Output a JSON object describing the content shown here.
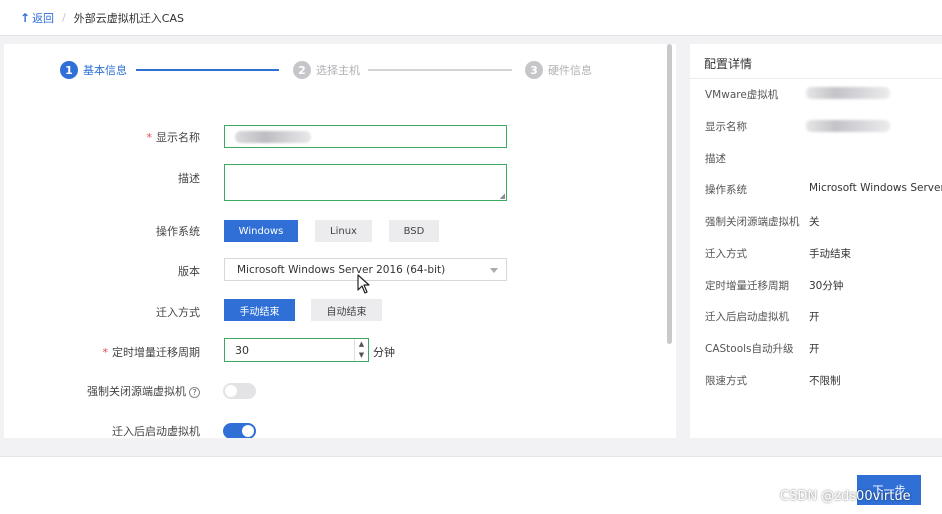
{
  "header": {
    "back_label": "返回",
    "title": "外部云虚拟机迁入CAS"
  },
  "steps": [
    {
      "num": "1",
      "label": "基本信息",
      "state": "active"
    },
    {
      "num": "2",
      "label": "选择主机",
      "state": "todo"
    },
    {
      "num": "3",
      "label": "硬件信息",
      "state": "todo"
    }
  ],
  "form": {
    "display_name_label": "显示名称",
    "description_label": "描述",
    "os_label": "操作系统",
    "os_options": [
      "Windows",
      "Linux",
      "BSD"
    ],
    "os_selected": "Windows",
    "version_label": "版本",
    "version_value": "Microsoft Windows Server 2016 (64-bit)",
    "migrate_mode_label": "迁入方式",
    "migrate_mode_options": [
      "手动结束",
      "自动结束"
    ],
    "migrate_mode_selected": "手动结束",
    "period_label": "定时增量迁移周期",
    "period_value": "30",
    "period_unit": "分钟",
    "force_shutdown_label": "强制关闭源端虚拟机",
    "force_shutdown_on": false,
    "start_after_label": "迁入后启动虚拟机",
    "start_after_on": true
  },
  "details": {
    "title": "配置详情",
    "rows": [
      {
        "key": "VMware虚拟机",
        "value": ""
      },
      {
        "key": "显示名称",
        "value": ""
      },
      {
        "key": "描述",
        "value": ""
      },
      {
        "key": "操作系统",
        "value": "Microsoft Windows Server"
      },
      {
        "key": "强制关闭源端虚拟机",
        "value": "关"
      },
      {
        "key": "迁入方式",
        "value": "手动结束"
      },
      {
        "key": "定时增量迁移周期",
        "value": "30分钟"
      },
      {
        "key": "迁入后启动虚拟机",
        "value": "开"
      },
      {
        "key": "CAStools自动升级",
        "value": "开"
      },
      {
        "key": "限速方式",
        "value": "不限制"
      }
    ]
  },
  "footer": {
    "next_label": "下一步",
    "watermark": "CSDN @zds00virtue"
  },
  "colors": {
    "accent": "#2f6fd6",
    "valid_border": "#3daa62",
    "required": "#e5484d"
  }
}
